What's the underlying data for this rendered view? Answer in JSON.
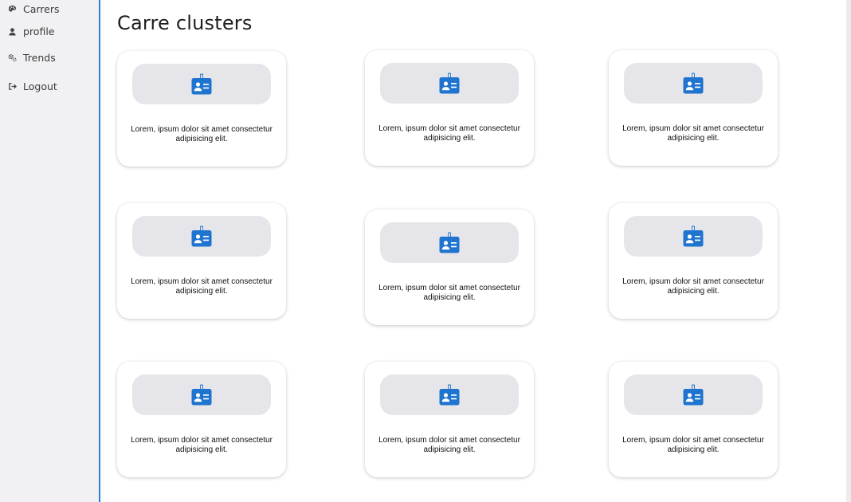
{
  "sidebar": {
    "items": [
      {
        "label": "Carrers",
        "icon": "palette-icon"
      },
      {
        "label": "profile",
        "icon": "user-icon"
      },
      {
        "label": "Trends",
        "icon": "gears-icon"
      },
      {
        "label": "Logout",
        "icon": "logout-icon"
      }
    ]
  },
  "main": {
    "title": "Carre clusters",
    "cards": [
      {
        "text": "Lorem, ipsum dolor sit amet consectetur adipisicing elit.",
        "icon": "id-badge-icon"
      },
      {
        "text": "Lorem, ipsum dolor sit amet consectetur adipisicing elit.",
        "icon": "id-badge-icon"
      },
      {
        "text": "Lorem, ipsum dolor sit amet consectetur adipisicing elit.",
        "icon": "id-badge-icon"
      },
      {
        "text": "Lorem, ipsum dolor sit amet consectetur adipisicing elit.",
        "icon": "id-badge-icon"
      },
      {
        "text": "Lorem, ipsum dolor sit amet consectetur adipisicing elit.",
        "icon": "id-badge-icon"
      },
      {
        "text": "Lorem, ipsum dolor sit amet consectetur adipisicing elit.",
        "icon": "id-badge-icon"
      },
      {
        "text": "Lorem, ipsum dolor sit amet consectetur adipisicing elit.",
        "icon": "id-badge-icon"
      },
      {
        "text": "Lorem, ipsum dolor sit amet consectetur adipisicing elit.",
        "icon": "id-badge-icon"
      },
      {
        "text": "Lorem, ipsum dolor sit amet consectetur adipisicing elit.",
        "icon": "id-badge-icon"
      }
    ]
  },
  "colors": {
    "accent": "#2f7fd6",
    "icon": "#1f74d0",
    "sidebar_bg": "#f1f1f3",
    "icon_box_bg": "#e6e6ea"
  }
}
